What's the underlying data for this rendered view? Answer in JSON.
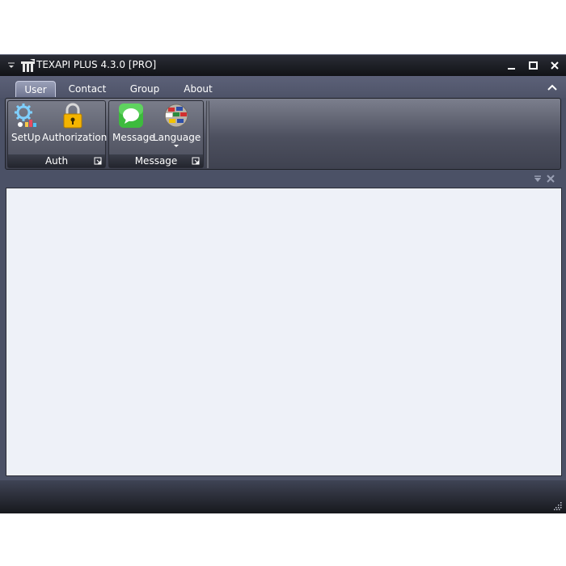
{
  "window": {
    "title": "TEXAPI PLUS 4.3.0 [PRO]",
    "icons": {
      "qat": "dropdown-arrow-icon",
      "app": "app-logo-icon",
      "minimize": "minimize-icon",
      "maximize": "maximize-icon",
      "close": "close-icon"
    }
  },
  "tabs": [
    {
      "label": "User",
      "active": true
    },
    {
      "label": "Contact",
      "active": false
    },
    {
      "label": "Group",
      "active": false
    },
    {
      "label": "About",
      "active": false
    }
  ],
  "ribbon": {
    "groups": [
      {
        "label": "Auth",
        "buttons": [
          {
            "label": "SetUp",
            "icon": "setup-gear-icon"
          },
          {
            "label": "Authorization",
            "icon": "padlock-icon"
          }
        ]
      },
      {
        "label": "Message",
        "buttons": [
          {
            "label": "Message",
            "icon": "message-bubble-icon"
          },
          {
            "label": "Language",
            "icon": "language-globe-icon"
          }
        ]
      }
    ]
  },
  "colors": {
    "chrome": "#4b5166",
    "content_bg": "#eef1f8",
    "title_bar": "#111216"
  }
}
